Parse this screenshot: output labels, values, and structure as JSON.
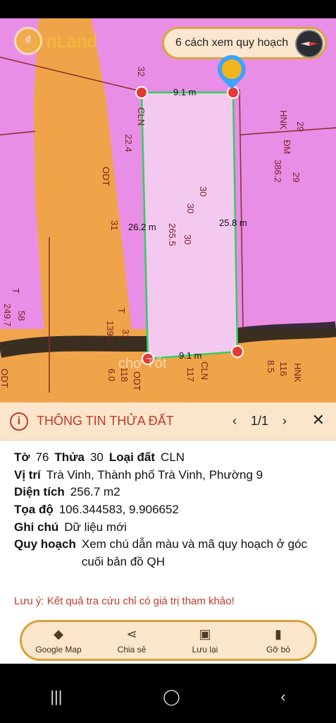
{
  "app": {
    "logo_text": "nLand",
    "logo_glyph": "₫"
  },
  "map": {
    "planning_button": "6 cách xem quy hoạch",
    "dims": {
      "top": "9.1 m",
      "left": "26.2 m",
      "right": "25.8 m",
      "bottom": "9.1 m"
    },
    "labels": {
      "plot32": "32",
      "cln": "CLN",
      "num224": "22.4",
      "odt1": "ODT",
      "num31a": "31",
      "hnk1": "HNK",
      "dm": "ĐM",
      "num29a": "29",
      "num29b": "29",
      "num3862": "386.2",
      "num30a": "30",
      "num30b": "30",
      "num30c": "30",
      "num2655": "265.5",
      "t1": "T",
      "num58": "58",
      "num2497": "249.7",
      "t2": "T",
      "num31b": "31",
      "num1392": "139.2",
      "odt2": "ODT",
      "odt3": "ODT",
      "num118": "118",
      "num60": "6.0",
      "cln2": "CLN",
      "num117": "117",
      "hnk2": "HNK",
      "num116": "116",
      "num85": "8.5",
      "watermark": "chợ Tốt"
    }
  },
  "panel": {
    "title": "THÔNG TIN THỬA ĐẤT",
    "pager": "1/1",
    "rows": {
      "to_label": "Tờ",
      "to_value": "76",
      "thua_label": "Thửa",
      "thua_value": "30",
      "loai_label": "Loại đất",
      "loai_value": "CLN",
      "vitri_label": "Vị trí",
      "vitri_value": "Trà Vinh, Thành phố Trà Vinh, Phường 9",
      "dientich_label": "Diện tích",
      "dientich_value": "256.7 m2",
      "toado_label": "Tọa độ",
      "toado_value": "106.344583, 9.906652",
      "ghichu_label": "Ghi chú",
      "ghichu_value": "Dữ liệu mới",
      "quyhoach_label": "Quy hoạch",
      "quyhoach_value": "Xem chú dẫn màu và mã quy hoạch ở góc cuối bản đồ QH"
    },
    "note": "Lưu ý: Kết quả tra cứu chỉ có giá trị tham khảo!"
  },
  "actions": [
    {
      "label": "Google Map",
      "icon": "directions-icon"
    },
    {
      "label": "Chia sẻ",
      "icon": "share-icon"
    },
    {
      "label": "Lưu lại",
      "icon": "save-icon"
    },
    {
      "label": "Gỡ bỏ",
      "icon": "trash-icon"
    }
  ],
  "colors": {
    "map_pink": "#e98ee6",
    "road_orange": "#f0a449",
    "accent_red": "#c0392b",
    "panel_header": "#fbe6cc"
  }
}
